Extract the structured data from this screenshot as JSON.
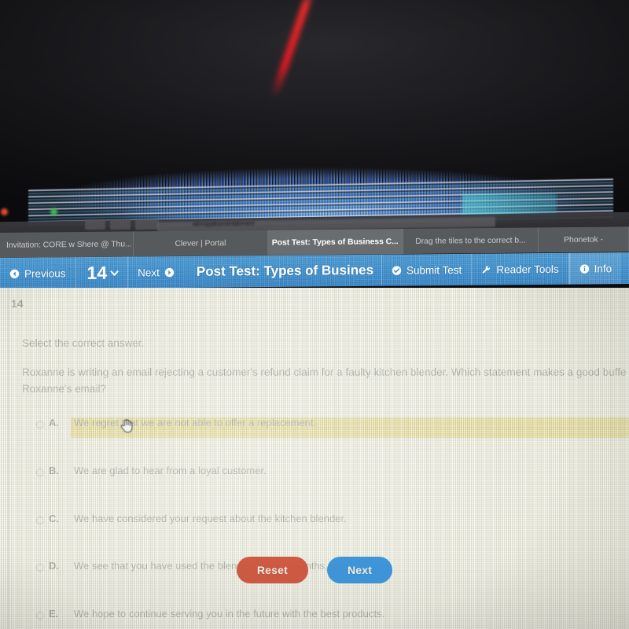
{
  "browser": {
    "tabs": [
      {
        "label": "Invitation: CORE w Shere @ Thu...",
        "active": false
      },
      {
        "label": "Clever | Portal",
        "active": false
      },
      {
        "label": "Post Test: Types of Business C...",
        "active": true
      },
      {
        "label": "Drag the tiles to the correct b...",
        "active": false
      },
      {
        "label": "Phonetok -",
        "active": false
      }
    ],
    "address_bar_text": "ethnopplicementainment"
  },
  "toolbar": {
    "previous_label": "Previous",
    "previous_icon": "arrow-left-circle-icon",
    "question_number": "14",
    "question_dropdown_icon": "chevron-down-icon",
    "next_label": "Next",
    "next_icon": "arrow-right-circle-icon",
    "title": "Post Test: Types of Busines",
    "submit_label": "Submit Test",
    "submit_icon": "check-circle-icon",
    "reader_tools_label": "Reader Tools",
    "reader_tools_icon": "wrench-icon",
    "info_label": "Info",
    "info_icon": "info-circle-icon",
    "background_color": "#3e93d4"
  },
  "question": {
    "number": "14",
    "instruction": "Select the correct answer.",
    "stem": "Roxanne is writing an email rejecting a customer's refund claim for a faulty kitchen blender. Which statement makes a good buffe\nRoxanne's email?",
    "options": [
      {
        "letter": "A.",
        "text": "We regret that we are not able to offer a replacement.",
        "selected": false,
        "highlighted": true
      },
      {
        "letter": "B.",
        "text": "We are glad to hear from a loyal customer.",
        "selected": false,
        "highlighted": false
      },
      {
        "letter": "C.",
        "text": "We have considered your request about the kitchen blender.",
        "selected": false,
        "highlighted": false
      },
      {
        "letter": "D.",
        "text": "We see that you have used the blender for nine months.",
        "selected": false,
        "highlighted": false
      },
      {
        "letter": "E.",
        "text": "We hope to continue serving you in the future with the best products.",
        "selected": false,
        "highlighted": false
      }
    ],
    "highlight_color": "#d8c34b"
  },
  "actions": {
    "reset_label": "Reset",
    "reset_color": "#cf5a44",
    "next_label": "Next",
    "next_color": "#3f96d8"
  },
  "cursor": {
    "icon": "pointing-hand-cursor-icon"
  }
}
